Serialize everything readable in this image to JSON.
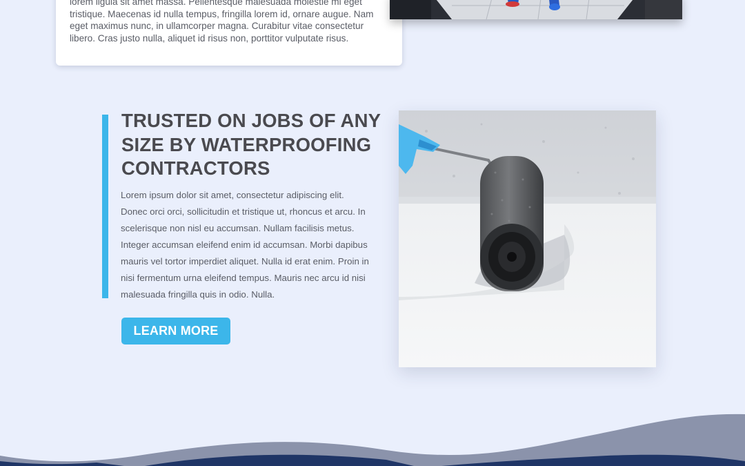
{
  "top_card": {
    "text": "lorem ligula sit amet massa. Pellentesque malesuada molestie mi eget tristique. Maecenas id nulla tempus, fringilla lorem id, ornare augue. Nam eget maximus nunc, in ullamcorper magna. Curabitur vitae consectetur libero. Cras justo nulla, aliquet id risus non, porttitor vulputate risus."
  },
  "feature": {
    "headline": "TRUSTED ON JOBS OF ANY SIZE BY WATERPROOFING CONTRACTORS",
    "body": "Lorem ipsum dolor sit amet, consectetur adipiscing elit. Donec orci orci, sollicitudin et tristique ut, rhoncus et arcu. In scelerisque non nisl eu accumsan. Nullam facilisis metus. Integer accumsan eleifend enim id accumsan. Morbi dapibus mauris vel tortor imperdiet aliquet. Nulla id erat enim. Proin in nisi fermentum urna eleifend tempus. Mauris nec arcu id nisi malesuada fringilla quis in odio. Nulla.",
    "button_label": "LEARN MORE"
  },
  "colors": {
    "background": "#eaeffc",
    "accent": "#3cb6ea",
    "heading": "#4a4a4f",
    "body": "#5a5d66",
    "wave_dark": "#1f3566",
    "wave_mid": "#8b93ab"
  },
  "icons": {
    "top_image": "worker-feet-on-tile-photo",
    "feature_image": "paint-roller-waterproofing-photo"
  }
}
